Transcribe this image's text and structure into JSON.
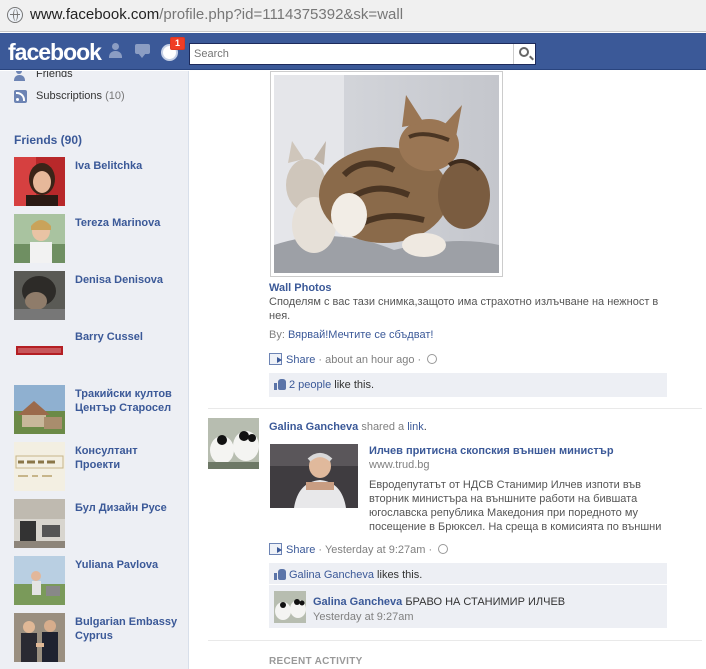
{
  "browser": {
    "url_host": "www.facebook.com",
    "url_path": "/profile.php?id=1114375392&sk=wall"
  },
  "header": {
    "logo": "facebook",
    "notification_count": "1",
    "search_placeholder": "Search"
  },
  "sidebar": {
    "nav": [
      {
        "label": "Friends",
        "count": ""
      },
      {
        "label": "Subscriptions",
        "count": "(10)"
      }
    ],
    "friends_heading": "Friends (90)",
    "friends": [
      {
        "name": "Iva Belitchka"
      },
      {
        "name": "Tereza Marinova"
      },
      {
        "name": "Denisa Denisova"
      },
      {
        "name": "Barry Cussel"
      },
      {
        "name": "Тракийски култов Център Старосел"
      },
      {
        "name": "Консултант Проекти"
      },
      {
        "name": "Бул Дизайн Русе"
      },
      {
        "name": "Yuliana Pavlova"
      },
      {
        "name": "Bulgarian Embassy Cyprus"
      }
    ]
  },
  "post1": {
    "album": "Wall Photos",
    "caption": "Споделям с вас тази снимка,защото има страхотно излъчване на нежност в нея.",
    "by_label": "By: ",
    "by_author": "Вярвай!Мечтите се сбъдват!",
    "share": "Share",
    "time": "about an hour ago",
    "likes_link": "2 people",
    "likes_text": " like this."
  },
  "post2": {
    "author": "Galina Gancheva",
    "shared_text": " shared a ",
    "link_word": "link",
    "period": ".",
    "link_title": "Илчев притисна скопския външен министър",
    "link_domain": "www.trud.bg",
    "link_desc": "Евродепутатът от НДСВ Станимир Илчев изпоти във вторник министъра на външните работи на бившата югославска република Македония при поредното му посещение в Брюксел. На среща в комисията по външни",
    "share": "Share",
    "time": "Yesterday at 9:27am",
    "liker": "Galina Gancheva",
    "likes_text": " likes this.",
    "comment_author": "Galina Gancheva",
    "comment_text": " БРАВО НА СТАНИМИР ИЛЧЕВ",
    "comment_time": "Yesterday at 9:27am"
  },
  "recent_activity": "RECENT ACTIVITY"
}
